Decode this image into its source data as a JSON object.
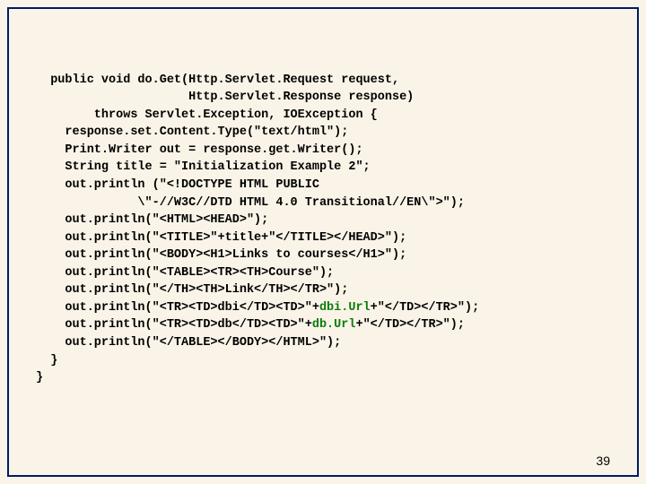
{
  "code": {
    "l1": "  public void do.Get(Http.Servlet.Request request,",
    "l2": "                     Http.Servlet.Response response)",
    "l3": "        throws Servlet.Exception, IOException {",
    "l4": "    response.set.Content.Type(\"text/html\");",
    "l5": "    Print.Writer out = response.get.Writer();",
    "l6": "    String title = \"Initialization Example 2\";",
    "l7": "    out.println (\"<!DOCTYPE HTML PUBLIC ",
    "l8": "              \\\"-//W3C//DTD HTML 4.0 Transitional//EN\\\">\");",
    "l9": "    out.println(\"<HTML><HEAD>\");",
    "l10": "    out.println(\"<TITLE>\"+title+\"</TITLE></HEAD>\");",
    "l11": "    out.println(\"<BODY><H1>Links to courses</H1>\");",
    "l12": "    out.println(\"<TABLE><TR><TH>Course\");",
    "l13": "    out.println(\"</TH><TH>Link</TH></TR>\");",
    "l14a": "    out.println(\"<TR><TD>dbi</TD><TD>\"+",
    "l14b": "dbi.Url",
    "l14c": "+\"</TD></TR>\");",
    "l15a": "    out.println(\"<TR><TD>db</TD><TD>\"+",
    "l15b": "db.Url",
    "l15c": "+\"</TD></TR>\");",
    "l16": "    out.println(\"</TABLE></BODY></HTML>\");",
    "l17": "  }",
    "l18": "}"
  },
  "page_number": "39"
}
